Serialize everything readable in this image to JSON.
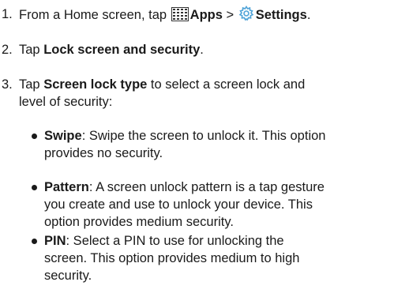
{
  "steps": [
    {
      "number": "1.",
      "prefix": "From a Home screen, tap ",
      "apps_icon": "apps-grid-icon",
      "apps_label": "Apps",
      "separator": " > ",
      "settings_icon": "settings-gear-icon",
      "settings_label": "Settings",
      "suffix": "."
    },
    {
      "number": "2.",
      "prefix": "Tap ",
      "bold": "Lock screen and security",
      "suffix": "."
    },
    {
      "number": "3.",
      "prefix": "Tap ",
      "bold": "Screen lock type",
      "line1_rest": " to select a screen lock and",
      "line2": "level of security:"
    }
  ],
  "bullets": [
    {
      "term": "Swipe",
      "lines": [
        ": Swipe the screen to unlock it. This option",
        "provides no security."
      ]
    },
    {
      "term": "Pattern",
      "lines": [
        ": A screen unlock pattern is a tap gesture",
        "you create and use to unlock your device. This",
        "option provides medium security."
      ]
    },
    {
      "term": "PIN",
      "lines": [
        ": Select a PIN to use for unlocking the",
        "screen. This option provides medium to high",
        "security."
      ]
    }
  ],
  "colors": {
    "text": "#1a1a1a",
    "settings_icon": "#4fa3d8",
    "apps_icon": "#333333"
  }
}
